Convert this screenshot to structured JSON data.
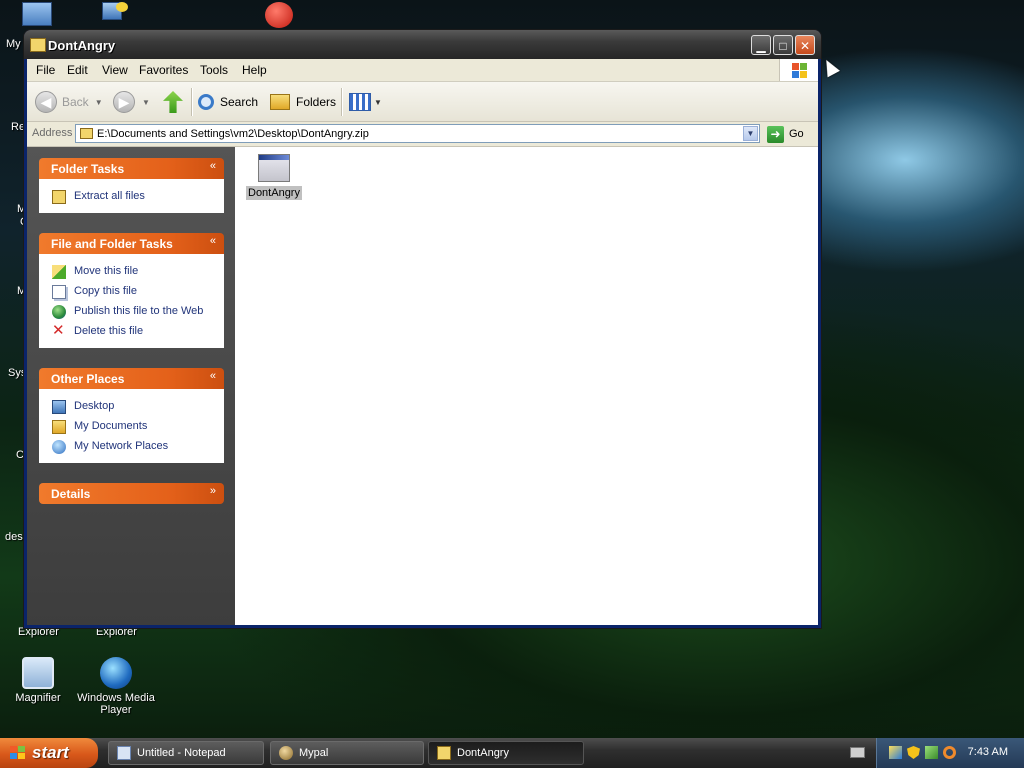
{
  "desktop": {
    "icons": [
      {
        "label": "Magnifier",
        "icon": "magnifier-icon"
      },
      {
        "label": "Windows Media Player",
        "icon": "media-player-icon"
      }
    ],
    "fragments": [
      {
        "text": "My",
        "icon": "my-computer-icon"
      },
      {
        "text": "Re"
      },
      {
        "text": "M"
      },
      {
        "text": "C"
      },
      {
        "text": "M"
      },
      {
        "text": "Sys"
      },
      {
        "text": "C"
      },
      {
        "text": "des"
      },
      {
        "text": "Explorer"
      },
      {
        "text": "Explorer"
      }
    ]
  },
  "window": {
    "title": "DontAngry",
    "menu": [
      "File",
      "Edit",
      "View",
      "Favorites",
      "Tools",
      "Help"
    ],
    "toolbar": {
      "back": "Back",
      "search": "Search",
      "folders": "Folders"
    },
    "address": {
      "label": "Address",
      "value": "E:\\Documents and Settings\\vm2\\Desktop\\DontAngry.zip",
      "go": "Go"
    },
    "panels": [
      {
        "title": "Folder Tasks",
        "chevron": "«",
        "items": [
          {
            "label": "Extract all files",
            "icon": "extract-icon"
          }
        ]
      },
      {
        "title": "File and Folder Tasks",
        "chevron": "«",
        "items": [
          {
            "label": "Move this file",
            "icon": "move-icon"
          },
          {
            "label": "Copy this file",
            "icon": "copy-icon"
          },
          {
            "label": "Publish this file to the Web",
            "icon": "publish-icon"
          },
          {
            "label": "Delete this file",
            "icon": "delete-icon"
          }
        ]
      },
      {
        "title": "Other Places",
        "chevron": "«",
        "items": [
          {
            "label": "Desktop",
            "icon": "desktop-icon"
          },
          {
            "label": "My Documents",
            "icon": "my-documents-icon"
          },
          {
            "label": "My Network Places",
            "icon": "network-places-icon"
          }
        ]
      },
      {
        "title": "Details",
        "chevron": "»",
        "items": []
      }
    ],
    "files": [
      {
        "label": "DontAngry",
        "icon": "application-icon"
      }
    ]
  },
  "taskbar": {
    "start": "start",
    "buttons": [
      {
        "label": "Untitled - Notepad",
        "icon": "notepad-icon"
      },
      {
        "label": "Mypal",
        "icon": "mypal-icon"
      },
      {
        "label": "DontAngry",
        "icon": "folder-icon"
      }
    ],
    "clock": "7:43 AM"
  }
}
